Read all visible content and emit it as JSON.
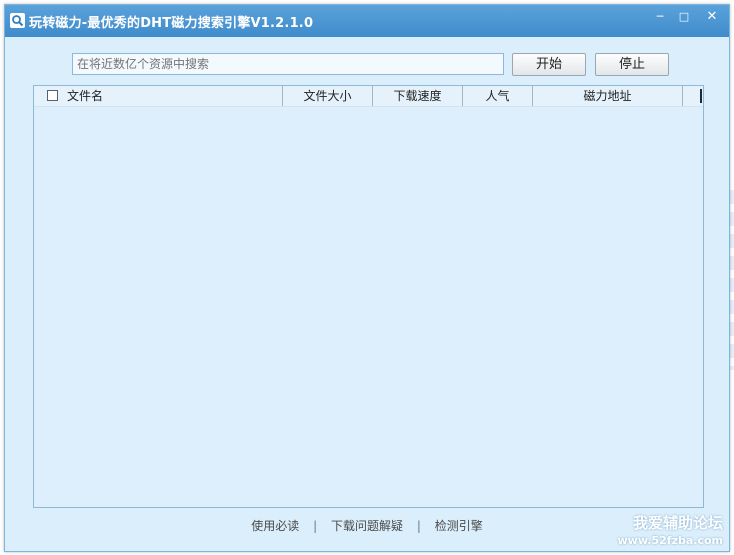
{
  "window": {
    "title": "玩转磁力-最优秀的DHT磁力搜索引擎V1.2.1.0",
    "controls": {
      "minimize": "─",
      "maximize": "□",
      "close": "✕"
    }
  },
  "search": {
    "placeholder": "在将近数亿个资源中搜索",
    "value": "",
    "start_label": "开始",
    "stop_label": "停止"
  },
  "table": {
    "columns": [
      "文件名",
      "文件大小",
      "下载速度",
      "人气",
      "磁力地址"
    ],
    "rows": []
  },
  "footer": {
    "links": [
      "使用必读",
      "下载问题解疑",
      "检测引擎"
    ],
    "separator": "|"
  },
  "watermark": {
    "line1": "我爱辅助论坛",
    "line2": "www.52fzba.com"
  },
  "colors": {
    "titlebar": "#4a95d2",
    "window_bg": "#dbeefb",
    "border": "#7fb4de"
  },
  "icons": {
    "app": "magnifier-icon"
  }
}
